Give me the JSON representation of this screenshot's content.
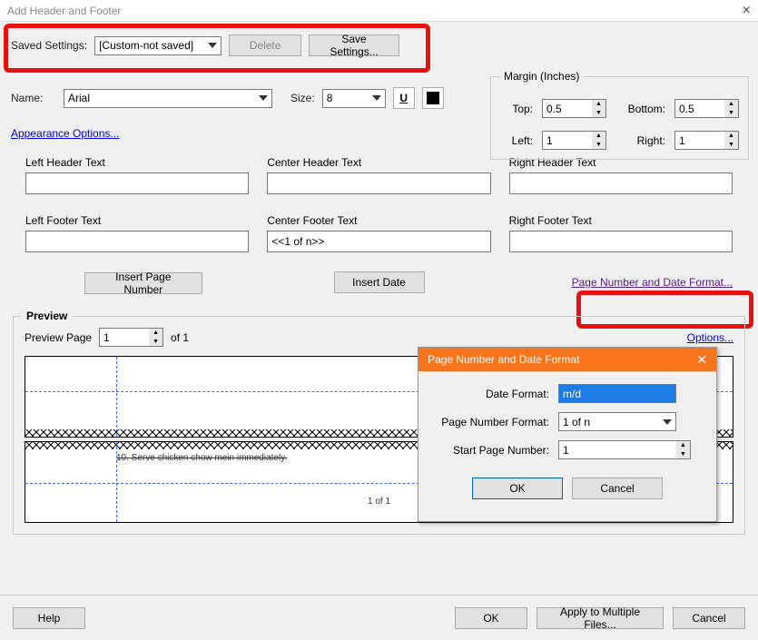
{
  "window": {
    "title": "Add Header and Footer"
  },
  "savedSettings": {
    "label": "Saved Settings:",
    "value": "[Custom-not saved]",
    "deleteLabel": "Delete",
    "saveLabel": "Save Settings..."
  },
  "font": {
    "nameLabel": "Name:",
    "nameValue": "Arial",
    "sizeLabel": "Size:",
    "sizeValue": "8"
  },
  "appearanceLink": "Appearance Options...",
  "margin": {
    "title": "Margin (Inches)",
    "topLabel": "Top:",
    "topValue": "0.5",
    "bottomLabel": "Bottom:",
    "bottomValue": "0.5",
    "leftLabel": "Left:",
    "leftValue": "1",
    "rightLabel": "Right:",
    "rightValue": "1"
  },
  "fields": {
    "leftHeaderLabel": "Left Header Text",
    "centerHeaderLabel": "Center Header Text",
    "rightHeaderLabel": "Right Header Text",
    "leftFooterLabel": "Left Footer Text",
    "centerFooterLabel": "Center Footer Text",
    "rightFooterLabel": "Right Footer Text",
    "leftHeaderValue": "",
    "centerHeaderValue": "",
    "rightHeaderValue": "",
    "leftFooterValue": "",
    "centerFooterValue": "<<1 of n>>",
    "rightFooterValue": ""
  },
  "insertButtons": {
    "pageNumber": "Insert Page Number",
    "date": "Insert Date"
  },
  "formatLink": "Page Number and Date Format...",
  "preview": {
    "title": "Preview",
    "pageLabel": "Preview Page",
    "pageValue": "1",
    "ofLabel": "of 1",
    "optionsLink": "Options...",
    "sampleText": "10. Serve chicken chow mein immediately.",
    "footerSample": "1 of 1"
  },
  "dialogBottom": {
    "help": "Help",
    "ok": "OK",
    "applyMultiple": "Apply to Multiple Files...",
    "cancel": "Cancel"
  },
  "popup": {
    "title": "Page Number and Date Format",
    "dateFormatLabel": "Date Format:",
    "dateFormatValue": "m/d",
    "pageNumFormatLabel": "Page Number Format:",
    "pageNumFormatValue": "1 of n",
    "startPageLabel": "Start Page Number:",
    "startPageValue": "1",
    "ok": "OK",
    "cancel": "Cancel"
  }
}
